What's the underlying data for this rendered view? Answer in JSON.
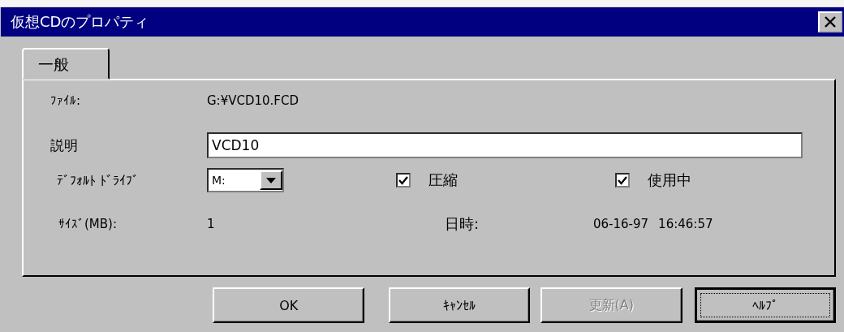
{
  "window": {
    "title": "仮想CDのプロパティ"
  },
  "tabs": [
    {
      "label": "一般",
      "selected": true
    }
  ],
  "file": {
    "label": "ﾌｧｲﾙ:",
    "value": "G:¥VCD10.FCD"
  },
  "description": {
    "label": "説明",
    "value": "VCD10"
  },
  "default_drive": {
    "label": "ﾃﾞﾌｫﾙﾄ ﾄﾞﾗｲﾌﾞ",
    "value": "M:"
  },
  "checkboxes": [
    {
      "label": "圧縮",
      "checked": true
    },
    {
      "label": "使用中",
      "checked": true
    }
  ],
  "size": {
    "label": "ｻｲｽﾞ(MB):",
    "value": "1"
  },
  "datetime": {
    "label": "日時:",
    "date": "06-16-97",
    "time": "16:46:57"
  },
  "buttons": [
    {
      "label": "OK",
      "disabled": false,
      "focused": false
    },
    {
      "label": "ｷｬﾝｾﾙ",
      "disabled": false,
      "focused": false
    },
    {
      "label": "更新(A)",
      "disabled": true,
      "focused": false
    },
    {
      "label": "ﾍﾙﾌﾟ",
      "disabled": false,
      "focused": true
    }
  ]
}
